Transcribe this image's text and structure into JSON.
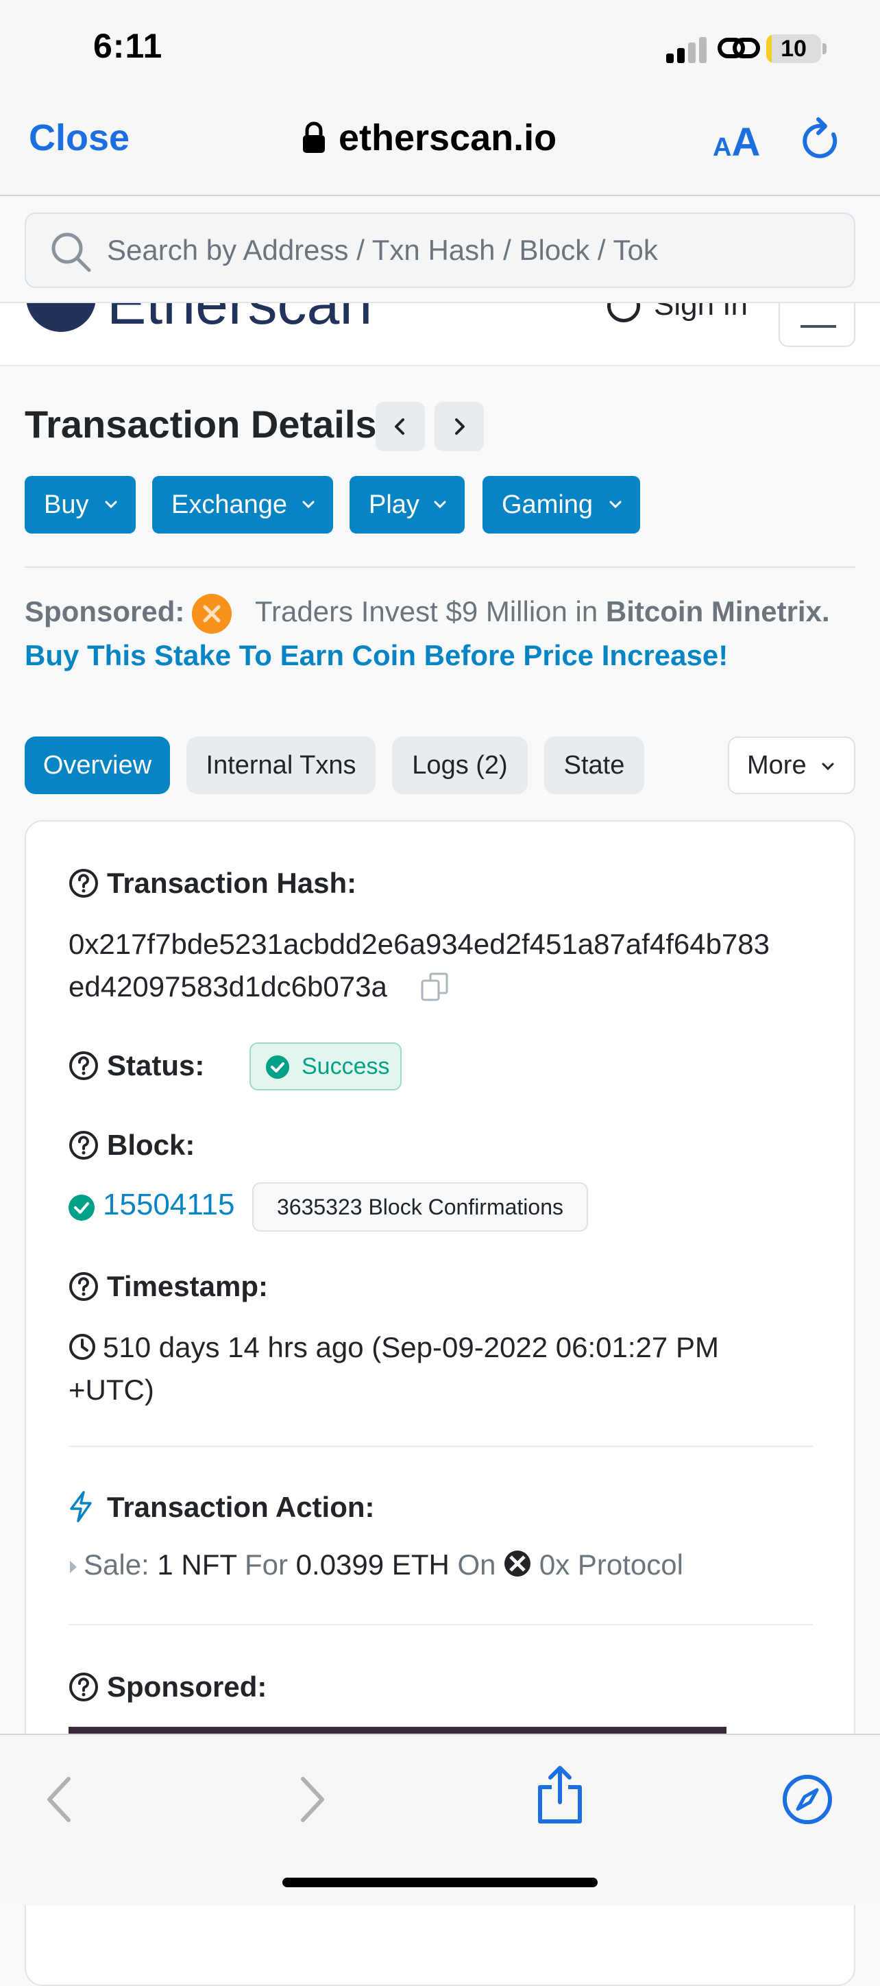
{
  "status_bar": {
    "time": "6:11",
    "battery_level": "10",
    "battery_fraction": 0.1
  },
  "browser": {
    "close_label": "Close",
    "domain": "etherscan.io",
    "text_size_small": "A",
    "text_size_large": "A"
  },
  "search": {
    "placeholder": "Search by Address / Txn Hash / Block / Tok"
  },
  "header": {
    "logo_text": "Etherscan",
    "sign_in": "Sign In"
  },
  "page": {
    "title": "Transaction Details",
    "categories": [
      "Buy",
      "Exchange",
      "Play",
      "Gaming"
    ]
  },
  "sponsored": {
    "label": "Sponsored:",
    "text_prefix": "Traders Invest $9 Million in",
    "text_bold": "Bitcoin Minetrix.",
    "link": "Buy This Stake To Earn Coin Before Price Increase!"
  },
  "tabs": [
    {
      "label": "Overview",
      "active": true
    },
    {
      "label": "Internal Txns",
      "active": false
    },
    {
      "label": "Logs (2)",
      "active": false
    },
    {
      "label": "State",
      "active": false
    }
  ],
  "more_label": "More",
  "details": {
    "hash_label": "Transaction Hash:",
    "hash_line1": "0x217f7bde5231acbdd2e6a934ed2f451a87af4f64b783",
    "hash_line2": "ed42097583d1dc6b073a",
    "status_label": "Status:",
    "status_value": "Success",
    "block_label": "Block:",
    "block_number": "15504115",
    "block_confirmations": "3635323 Block Confirmations",
    "timestamp_label": "Timestamp:",
    "timestamp_line1": "510 days 14 hrs ago (Sep-09-2022 06:01:27 PM",
    "timestamp_line2": "+UTC)",
    "action_label": "Transaction Action:",
    "action": {
      "sale": "Sale:",
      "amount": "1 NFT",
      "for": "For",
      "price": "0.0399 ETH",
      "on": "On",
      "protocol": "0x Protocol"
    },
    "sponsored_label": "Sponsored:"
  },
  "colors": {
    "primary": "#0784c3",
    "safari_blue": "#1b6fe0",
    "success": "#00a186"
  }
}
